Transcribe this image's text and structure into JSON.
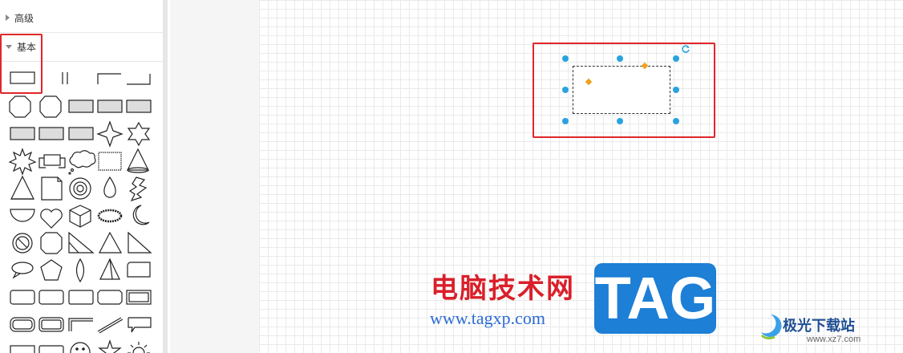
{
  "sidebar": {
    "sections": [
      {
        "label": "高级",
        "expanded": false
      },
      {
        "label": "基本",
        "expanded": true
      }
    ]
  },
  "watermark": {
    "site_cn": "电脑技术网",
    "site_url": "www.tagxp.com",
    "tag": "TAG",
    "jiguang": "极光下载站",
    "jiguang_url": "www.xz7.com"
  },
  "colors": {
    "highlight": "#e0262a",
    "handle": "#29a3e0",
    "control": "#f0a21a"
  }
}
